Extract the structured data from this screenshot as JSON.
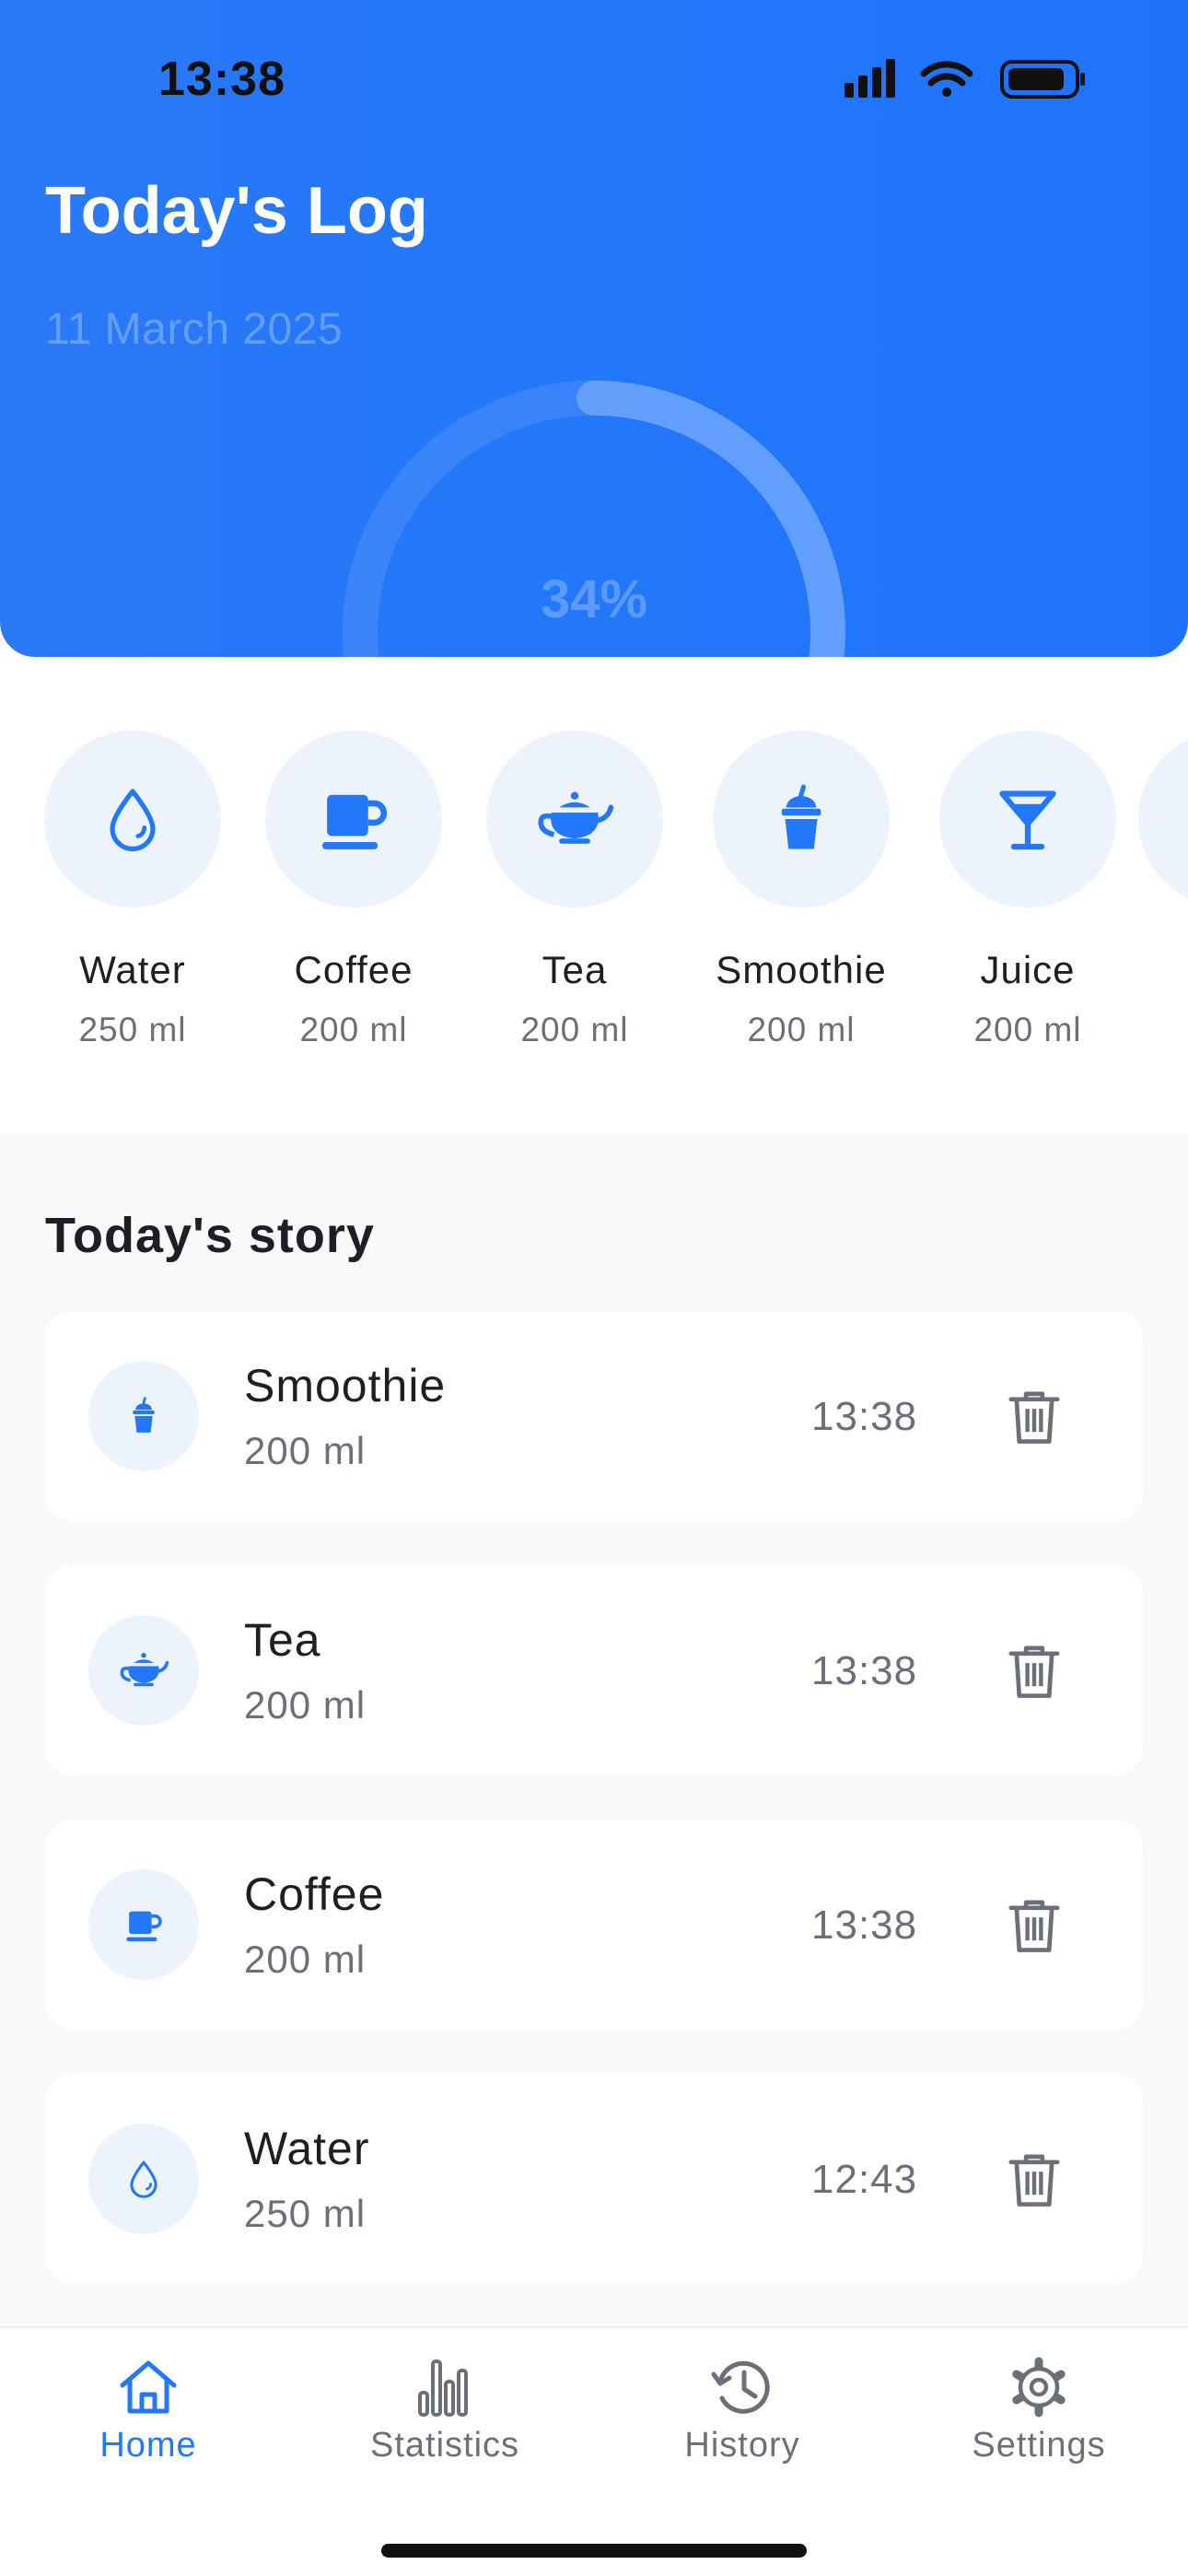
{
  "status_bar": {
    "time": "13:38"
  },
  "header": {
    "title": "Today's Log",
    "date": "11 March 2025",
    "progress_label": "34%",
    "progress_fraction": 0.34
  },
  "colors": {
    "accent": "#2277fb",
    "icon_bg": "#edf3fd",
    "muted": "#6b6f78"
  },
  "drinks": [
    {
      "name": "Water",
      "volume": "250 ml",
      "icon": "water-drop-icon"
    },
    {
      "name": "Coffee",
      "volume": "200 ml",
      "icon": "coffee-cup-icon"
    },
    {
      "name": "Tea",
      "volume": "200 ml",
      "icon": "teapot-icon"
    },
    {
      "name": "Smoothie",
      "volume": "200 ml",
      "icon": "smoothie-cup-icon"
    },
    {
      "name": "Juice",
      "volume": "200 ml",
      "icon": "cocktail-glass-icon"
    }
  ],
  "story": {
    "title": "Today's story",
    "entries": [
      {
        "name": "Smoothie",
        "volume": "200 ml",
        "time": "13:38",
        "icon": "smoothie-cup-icon"
      },
      {
        "name": "Tea",
        "volume": "200 ml",
        "time": "13:38",
        "icon": "teapot-icon"
      },
      {
        "name": "Coffee",
        "volume": "200 ml",
        "time": "13:38",
        "icon": "coffee-cup-icon"
      },
      {
        "name": "Water",
        "volume": "250 ml",
        "time": "12:43",
        "icon": "water-drop-icon"
      }
    ]
  },
  "tabs": [
    {
      "label": "Home",
      "icon": "home-icon",
      "active": true
    },
    {
      "label": "Statistics",
      "icon": "bar-chart-icon",
      "active": false
    },
    {
      "label": "History",
      "icon": "history-clock-icon",
      "active": false
    },
    {
      "label": "Settings",
      "icon": "gear-icon",
      "active": false
    }
  ]
}
